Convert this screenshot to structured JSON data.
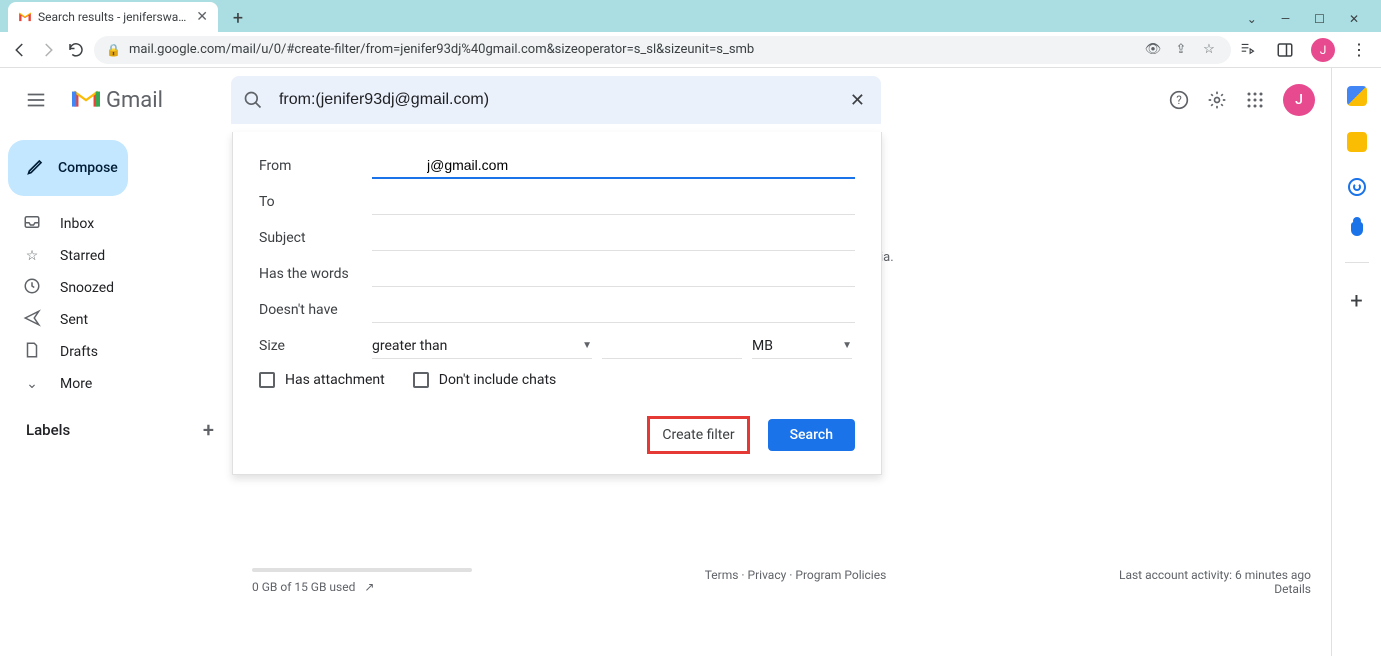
{
  "browser": {
    "tab_title": "Search results - jeniferswagathdj",
    "url": "mail.google.com/mail/u/0/#create-filter/from=jenifer93dj%40gmail.com&sizeoperator=s_sl&sizeunit=s_smb",
    "avatar_initial": "J"
  },
  "header": {
    "app_name": "Gmail",
    "search_value": "from:(jenifer93dj@gmail.com)",
    "avatar_initial": "J"
  },
  "sidebar": {
    "compose": "Compose",
    "items": [
      {
        "label": "Inbox"
      },
      {
        "label": "Starred"
      },
      {
        "label": "Snoozed"
      },
      {
        "label": "Sent"
      },
      {
        "label": "Drafts"
      },
      {
        "label": "More"
      }
    ],
    "labels_heading": "Labels"
  },
  "filter": {
    "from_label": "From",
    "from_value": "j@gmail.com",
    "to_label": "To",
    "subject_label": "Subject",
    "haswords_label": "Has the words",
    "doesnt_label": "Doesn't have",
    "size_label": "Size",
    "size_op": "greater than",
    "size_unit": "MB",
    "attach_label": "Has attachment",
    "chats_label": "Don't include chats",
    "create_filter": "Create filter",
    "search_btn": "Search"
  },
  "peek_text": "ia.",
  "footer": {
    "storage": "0 GB of 15 GB used",
    "terms": "Terms",
    "privacy": "Privacy",
    "policies": "Program Policies",
    "activity": "Last account activity: 6 minutes ago",
    "details": "Details"
  }
}
